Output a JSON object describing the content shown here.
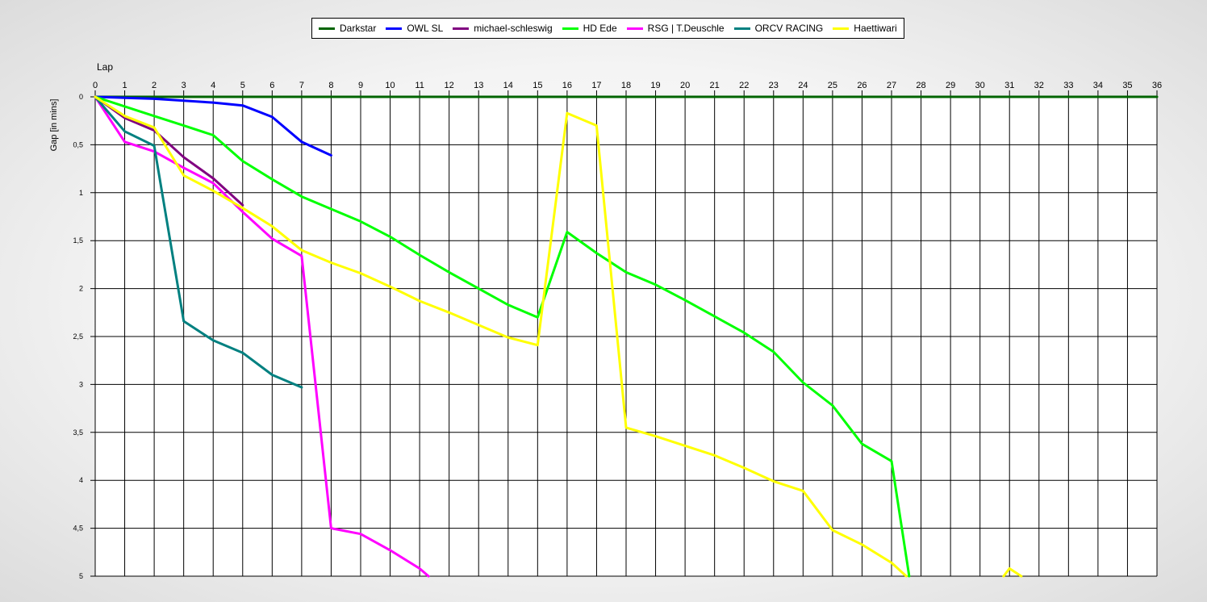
{
  "chart_data": {
    "type": "line",
    "xlabel": "Lap",
    "ylabel": "Gap [in mins]",
    "xlim": [
      0,
      36
    ],
    "ylim": [
      0,
      5
    ],
    "x_axis_position": "top",
    "y_inverted": true,
    "grid": true,
    "legend_position": "top-center",
    "x_ticks": [
      "0",
      "1",
      "2",
      "3",
      "4",
      "5",
      "6",
      "7",
      "8",
      "9",
      "10",
      "11",
      "12",
      "13",
      "14",
      "15",
      "16",
      "17",
      "18",
      "19",
      "20",
      "21",
      "22",
      "23",
      "24",
      "25",
      "26",
      "27",
      "28",
      "29",
      "30",
      "31",
      "32",
      "33",
      "34",
      "35",
      "36"
    ],
    "y_ticks": [
      {
        "value": 0,
        "label": "0"
      },
      {
        "value": 0.5,
        "label": "0,5"
      },
      {
        "value": 1,
        "label": "1"
      },
      {
        "value": 1.5,
        "label": "1,5"
      },
      {
        "value": 2,
        "label": "2"
      },
      {
        "value": 2.5,
        "label": "2,5"
      },
      {
        "value": 3,
        "label": "3"
      },
      {
        "value": 3.5,
        "label": "3,5"
      },
      {
        "value": 4,
        "label": "4"
      },
      {
        "value": 4.5,
        "label": "4,5"
      },
      {
        "value": 5,
        "label": "5"
      }
    ],
    "series": [
      {
        "name": "Darkstar",
        "color": "#006400",
        "x": [
          0,
          36
        ],
        "y": [
          0,
          0
        ]
      },
      {
        "name": "OWL SL",
        "color": "#0000ff",
        "x": [
          0,
          1,
          2,
          3,
          4,
          5,
          6,
          7,
          8
        ],
        "y": [
          0,
          0.01,
          0.02,
          0.04,
          0.06,
          0.09,
          0.21,
          0.47,
          0.61
        ]
      },
      {
        "name": "michael-schleswig",
        "color": "#800080",
        "x": [
          0,
          1,
          2,
          3,
          4,
          5
        ],
        "y": [
          0,
          0.22,
          0.35,
          0.63,
          0.85,
          1.13
        ]
      },
      {
        "name": "HD Ede",
        "color": "#00ff00",
        "x": [
          0,
          1,
          2,
          3,
          4,
          5,
          6,
          7,
          8,
          9,
          10,
          11,
          12,
          13,
          14,
          15,
          16,
          17,
          18,
          19,
          20,
          21,
          22,
          23,
          24,
          25,
          26,
          27,
          27.6
        ],
        "y": [
          0,
          0.1,
          0.2,
          0.3,
          0.4,
          0.67,
          0.86,
          1.04,
          1.17,
          1.3,
          1.46,
          1.65,
          1.83,
          2.0,
          2.17,
          2.3,
          1.41,
          1.63,
          1.83,
          1.96,
          2.12,
          2.29,
          2.46,
          2.66,
          2.98,
          3.22,
          3.62,
          3.8,
          5.0
        ]
      },
      {
        "name": "RSG | T.Deuschle",
        "color": "#ff00ff",
        "x": [
          0,
          1,
          2,
          3,
          4,
          5,
          6,
          7,
          8,
          9,
          10,
          11,
          11.3
        ],
        "y": [
          0,
          0.47,
          0.57,
          0.74,
          0.9,
          1.2,
          1.48,
          1.66,
          4.5,
          4.56,
          4.73,
          4.92,
          5.0
        ]
      },
      {
        "name": "ORCV RACING",
        "color": "#008080",
        "x": [
          0,
          1,
          2,
          3,
          4,
          5,
          6,
          7
        ],
        "y": [
          0,
          0.36,
          0.51,
          2.34,
          2.54,
          2.67,
          2.9,
          3.03
        ]
      },
      {
        "name": "Haettiwari",
        "color": "#ffff00",
        "x": [
          0,
          1,
          2,
          3,
          4,
          5,
          6,
          7,
          8,
          9,
          10,
          11,
          12,
          13,
          14,
          15,
          16,
          17,
          18,
          19,
          20,
          21,
          22,
          23,
          24,
          25,
          26,
          27,
          27.5
        ],
        "y": [
          0,
          0.2,
          0.32,
          0.82,
          0.98,
          1.16,
          1.35,
          1.6,
          1.73,
          1.84,
          1.98,
          2.13,
          2.25,
          2.38,
          2.51,
          2.59,
          0.17,
          0.3,
          3.45,
          3.54,
          3.64,
          3.74,
          3.87,
          4.01,
          4.11,
          4.52,
          4.67,
          4.86,
          5.0
        ]
      },
      {
        "name": "Haettiwari",
        "color": "#ffff00",
        "legend": false,
        "x": [
          30.8,
          31,
          31.4
        ],
        "y": [
          5.0,
          4.92,
          5.0
        ]
      }
    ]
  }
}
